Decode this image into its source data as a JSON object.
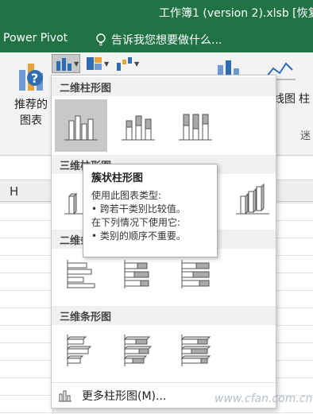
{
  "titlebar": {
    "title": "工作簿1 (version 2).xlsb [恢复",
    "tab_power_pivot": "Power Pivot",
    "tell_me": "告诉我您想要做什么..."
  },
  "ribbon": {
    "recommended_charts_label": "推荐的\n图表",
    "line_label": "线图",
    "column_label": "柱",
    "mini_label": "迷"
  },
  "sheet": {
    "column_header": "H"
  },
  "dropdown": {
    "sections": [
      {
        "title": "二维柱形图"
      },
      {
        "title": "三维柱形图"
      },
      {
        "title": "二维条形图"
      },
      {
        "title": "三维条形图"
      }
    ],
    "more_label": "更多柱形图(M)..."
  },
  "tooltip": {
    "title": "簇状柱形图",
    "lines": [
      "使用此图表类型:",
      "• 跨若干类别比较值。",
      "在下列情况下使用它:",
      "• 类别的顺序不重要。"
    ]
  },
  "watermark": "www.cfan.com.cn",
  "colors": {
    "accent": "#217346",
    "selected_tile": "#c8c8c8"
  }
}
